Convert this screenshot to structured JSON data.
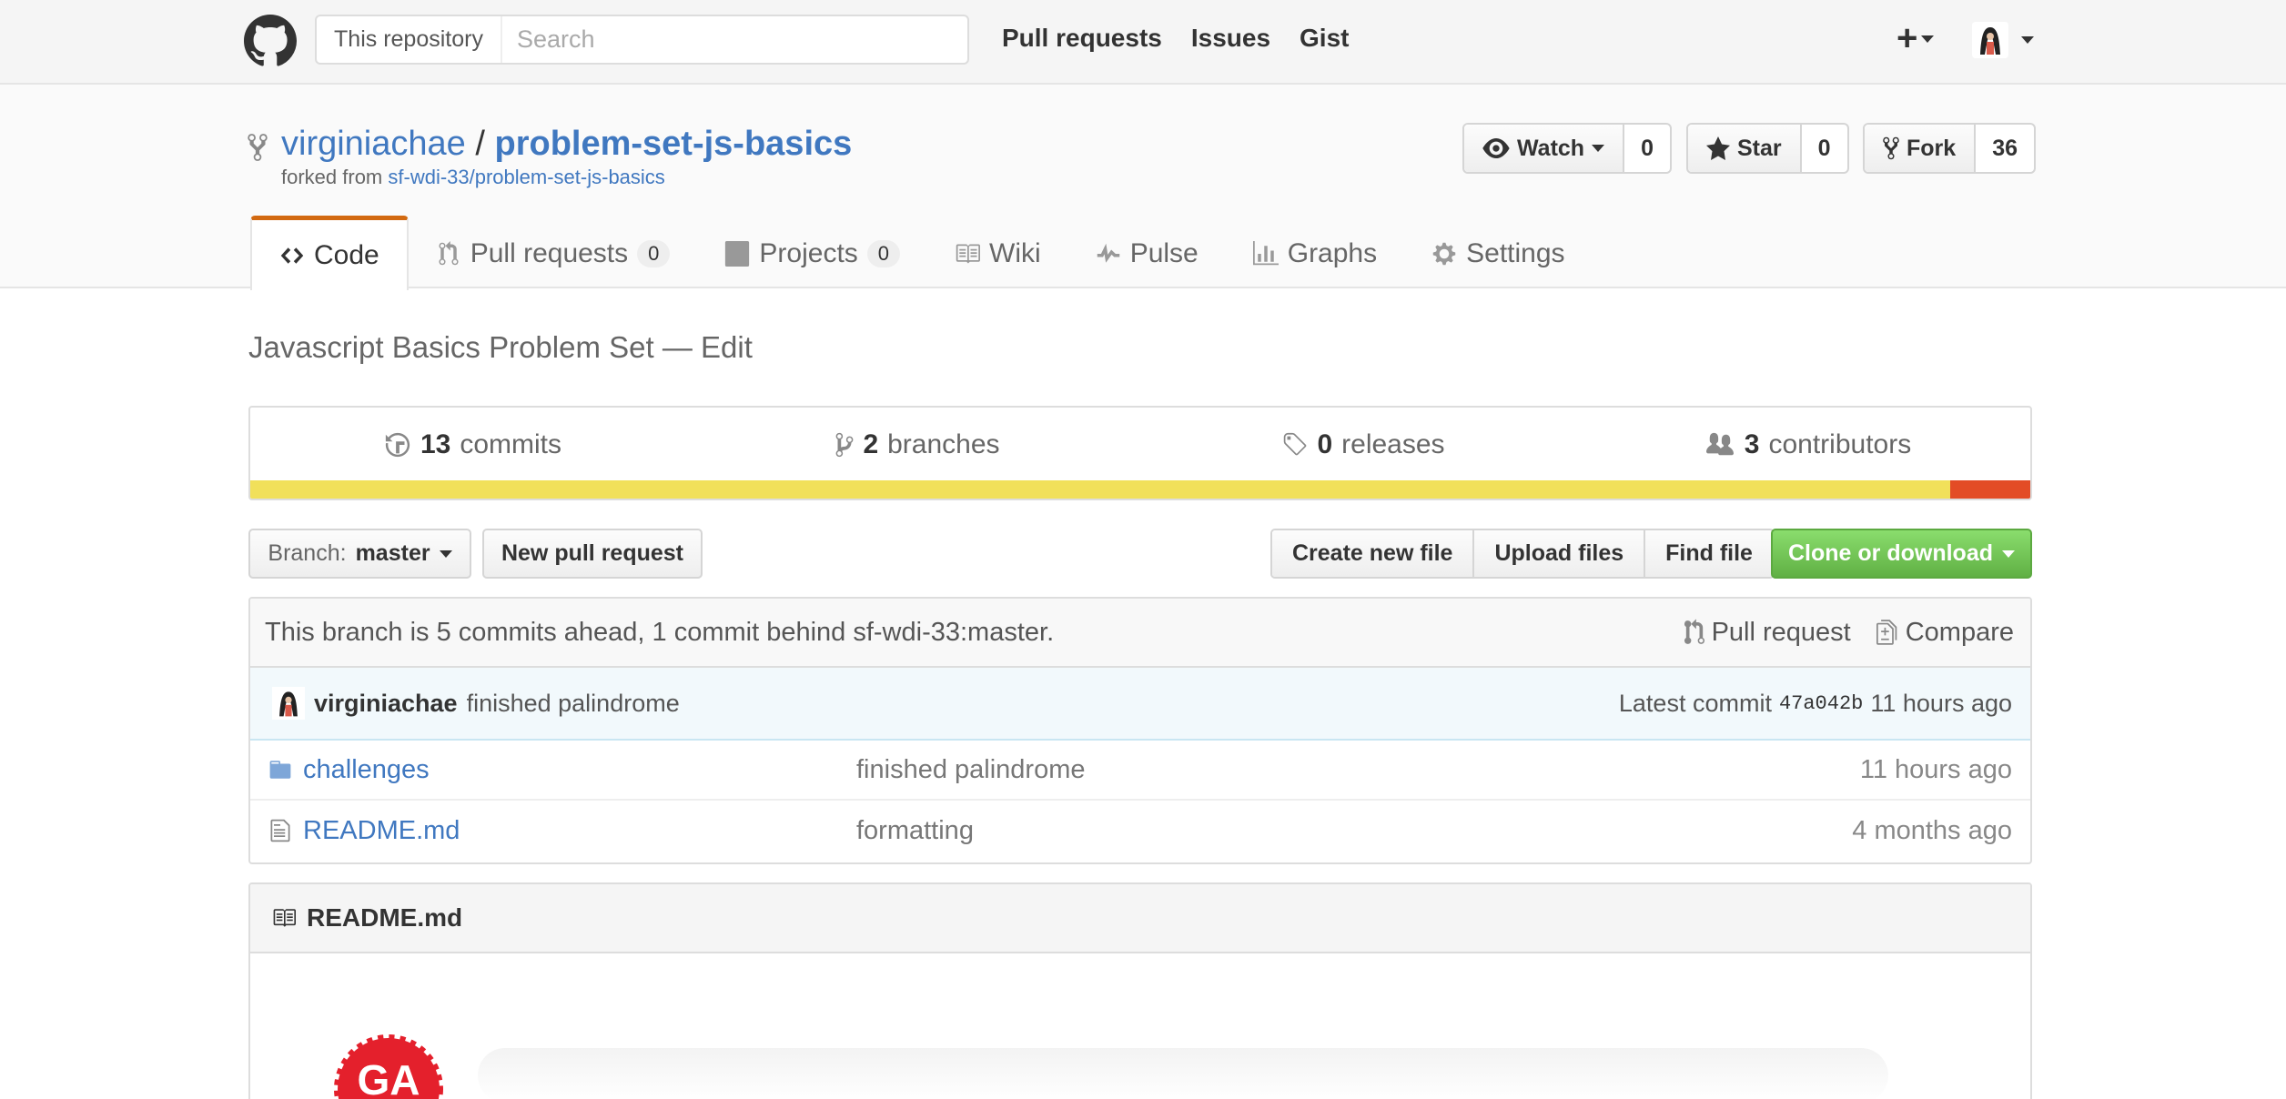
{
  "header": {
    "scope_label": "This repository",
    "search_placeholder": "Search",
    "nav": [
      "Pull requests",
      "Issues",
      "Gist"
    ],
    "plus_label": "+"
  },
  "repo": {
    "owner": "virginiachae",
    "separator": "/",
    "name": "problem-set-js-basics",
    "forked_prefix": "forked from",
    "forked_source": "sf-wdi-33/problem-set-js-basics",
    "description": "Javascript Basics Problem Set — Edit"
  },
  "actions": {
    "watch": {
      "label": "Watch",
      "count": "0"
    },
    "star": {
      "label": "Star",
      "count": "0"
    },
    "fork": {
      "label": "Fork",
      "count": "36"
    }
  },
  "tabs": [
    {
      "label": "Code",
      "counter": ""
    },
    {
      "label": "Pull requests",
      "counter": "0"
    },
    {
      "label": "Projects",
      "counter": "0"
    },
    {
      "label": "Wiki",
      "counter": ""
    },
    {
      "label": "Pulse",
      "counter": ""
    },
    {
      "label": "Graphs",
      "counter": ""
    },
    {
      "label": "Settings",
      "counter": ""
    }
  ],
  "summary": {
    "commits": {
      "count": "13",
      "label": "commits"
    },
    "branches": {
      "count": "2",
      "label": "branches"
    },
    "releases": {
      "count": "0",
      "label": "releases"
    },
    "contributors": {
      "count": "3",
      "label": "contributors"
    }
  },
  "language_bar": {
    "segments": [
      {
        "color": "#f1e05a",
        "percent": 95.5
      },
      {
        "color": "#e34c26",
        "percent": 4.5
      }
    ]
  },
  "file_nav": {
    "branch_prefix": "Branch:",
    "branch_name": "master",
    "new_pr": "New pull request",
    "create_file": "Create new file",
    "upload_files": "Upload files",
    "find_file": "Find file",
    "clone": "Clone or download"
  },
  "branch_status": {
    "text": "This branch is 5 commits ahead, 1 commit behind sf-wdi-33:master.",
    "pull_request": "Pull request",
    "compare": "Compare"
  },
  "latest_commit": {
    "author": "virginiachae",
    "message": "finished palindrome",
    "label": "Latest commit",
    "sha": "47a042b",
    "age": "11 hours ago"
  },
  "files": [
    {
      "type": "folder",
      "name": "challenges",
      "message": "finished palindrome",
      "age": "11 hours ago"
    },
    {
      "type": "file",
      "name": "README.md",
      "message": "formatting",
      "age": "4 months ago"
    }
  ],
  "readme": {
    "title": "README.md",
    "logo_text": "GA"
  },
  "colors": {
    "link": "#4078c0",
    "accent_tab": "#d26911",
    "green_button": "#60b044"
  }
}
